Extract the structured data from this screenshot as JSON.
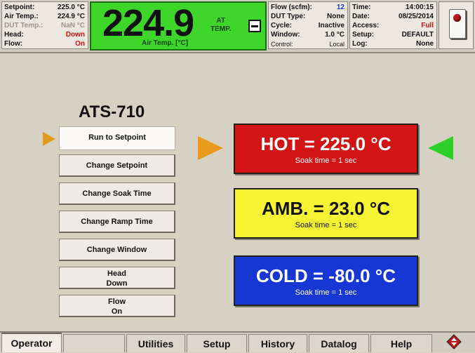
{
  "status_left": {
    "rows": [
      {
        "label": "Setpoint:",
        "value": "225.0 °C",
        "tone": "normal"
      },
      {
        "label": "Air Temp.:",
        "value": "224.9 °C",
        "tone": "normal"
      },
      {
        "label": "DUT Temp.:",
        "value": "NaN °C",
        "tone": "grey"
      },
      {
        "label": "Head:",
        "value": "Down",
        "tone": "red"
      },
      {
        "label": "Flow:",
        "value": "On",
        "tone": "red"
      }
    ]
  },
  "display": {
    "value": "224.9",
    "label": "Air Temp. [°C]",
    "status_line1": "AT",
    "status_line2": "TEMP.",
    "color": "#3fd62b"
  },
  "status_mid": {
    "rows": [
      {
        "label": "Flow (scfm):",
        "value": "12",
        "tone": "blue"
      },
      {
        "label": "DUT Type:",
        "value": "None",
        "tone": "normal"
      },
      {
        "label": "Cycle:",
        "value": "Inactive",
        "tone": "normal"
      },
      {
        "label": "Window:",
        "value": "1.0 °C",
        "tone": "normal"
      },
      {
        "label": "Control:",
        "value": "Local",
        "tone": "small"
      }
    ]
  },
  "status_right": {
    "rows": [
      {
        "label": "Time:",
        "value": "14:00:15",
        "tone": "normal"
      },
      {
        "label": "Date:",
        "value": "08/25/2014",
        "tone": "normal"
      },
      {
        "label": "Access:",
        "value": "Full",
        "tone": "red"
      },
      {
        "label": "Setup:",
        "value": "DEFAULT",
        "tone": "normal"
      },
      {
        "label": "Log:",
        "value": "None",
        "tone": "normal"
      }
    ]
  },
  "model": "ATS-710",
  "buttons": {
    "run_to_setpoint": "Run to Setpoint",
    "change_setpoint": "Change Setpoint",
    "change_soak_time": "Change Soak Time",
    "change_ramp_time": "Change Ramp Time",
    "change_window": "Change Window",
    "head_line1": "Head",
    "head_line2": "Down",
    "flow_line1": "Flow",
    "flow_line2": "On"
  },
  "setpoints": {
    "hot": {
      "title": "HOT = 225.0 °C",
      "soak": "Soak time = 1 sec",
      "color": "#d21414"
    },
    "amb": {
      "title": "AMB. = 23.0 °C",
      "soak": "Soak time = 1 sec",
      "color": "#f7f433"
    },
    "cold": {
      "title": "COLD = -80.0 °C",
      "soak": "Soak time = 1 sec",
      "color": "#1737d4"
    }
  },
  "tabs": [
    {
      "label": "Operator",
      "active": true
    },
    {
      "label": "",
      "active": false
    },
    {
      "label": "Utilities",
      "active": false
    },
    {
      "label": "Setup",
      "active": false
    },
    {
      "label": "History",
      "active": false
    },
    {
      "label": "Datalog",
      "active": false
    },
    {
      "label": "Help",
      "active": false
    }
  ],
  "icons": {
    "estop": "estop-switch-icon",
    "logo": "diamond-logo-icon"
  }
}
